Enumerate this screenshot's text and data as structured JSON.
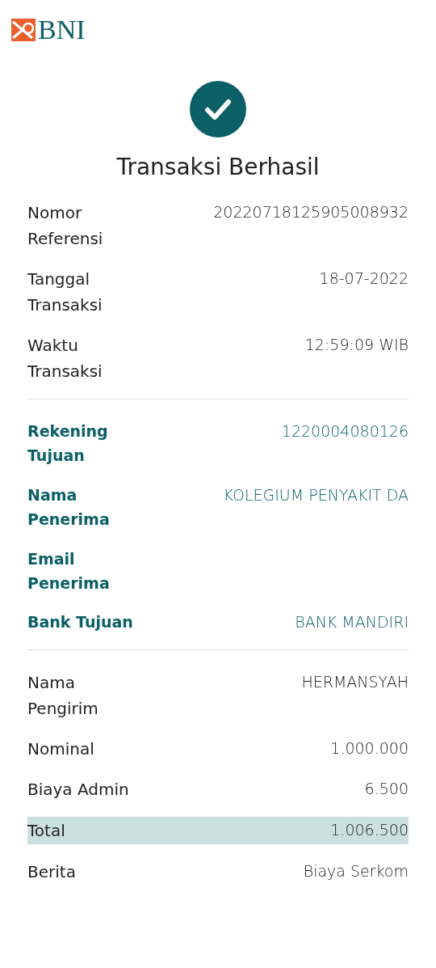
{
  "logo": {
    "text": "BNI"
  },
  "status": {
    "title": "Transaksi Berhasil"
  },
  "sections": [
    {
      "accent": false,
      "rows": [
        {
          "label": "Nomor Referensi",
          "value": "20220718125905008932",
          "highlighted": false
        },
        {
          "label": "Tanggal Transaksi",
          "value": "18-07-2022",
          "highlighted": false
        },
        {
          "label": "Waktu Transaksi",
          "value": "12:59:09 WIB",
          "highlighted": false
        }
      ]
    },
    {
      "accent": true,
      "rows": [
        {
          "label": "Rekening Tujuan",
          "value": "1220004080126",
          "highlighted": false
        },
        {
          "label": "Nama Penerima",
          "value": "KOLEGIUM PENYAKIT DA",
          "highlighted": false
        },
        {
          "label": "Email Penerima",
          "highlighted": false
        },
        {
          "label": "Bank Tujuan",
          "value": "BANK MANDIRI",
          "highlighted": false
        }
      ]
    },
    {
      "accent": false,
      "rows": [
        {
          "label": "Nama Pengirim",
          "value": "HERMANSYAH",
          "highlighted": false
        },
        {
          "label": "Nominal",
          "value": "1.000.000",
          "highlighted": false
        },
        {
          "label": "Biaya Admin",
          "value": "6.500",
          "highlighted": false
        },
        {
          "label": "Total",
          "value": "1.006.500",
          "highlighted": true
        },
        {
          "label": "Berita",
          "value": "Biaya Serkom",
          "highlighted": false
        }
      ]
    }
  ]
}
